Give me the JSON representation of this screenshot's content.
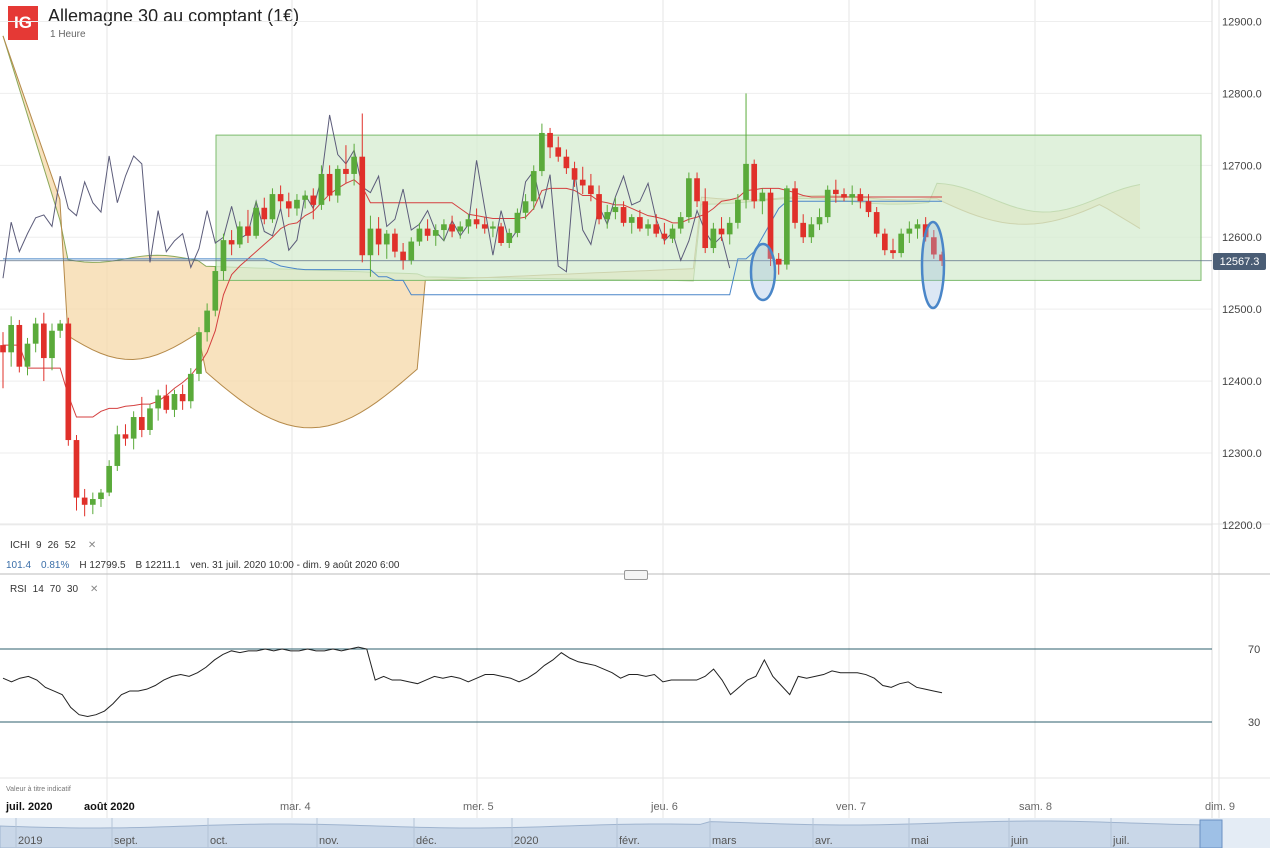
{
  "header": {
    "logo": "IG",
    "title": "Allemagne 30 au comptant (1€)",
    "timeframe": "1 Heure"
  },
  "indicators": {
    "ichimoku": {
      "name": "ICHI",
      "p1": "9",
      "p2": "26",
      "p3": "52"
    },
    "rsi": {
      "name": "RSI",
      "p1": "14",
      "p2": "70",
      "p3": "30"
    }
  },
  "stats": {
    "value": "101.4",
    "change": "0.81%",
    "high": "H 12799.5",
    "low": "B 12211.1",
    "range": "ven. 31 juil. 2020 10:00 - dim. 9 août 2020 6:00"
  },
  "price_tag": "12567.3",
  "disclaimer": "Valeur à titre indicatif",
  "colors": {
    "up": "#5aaa3a",
    "down": "#e0302a",
    "box_fill": "#d6ecd0",
    "box_stroke": "#7cbb6c",
    "cloud_orange": "#f6d8a8",
    "cloud_green": "#ddd7a8",
    "tenkan": "#d43f3f",
    "kijun": "#4a86c8",
    "chikou": "#5c5c7a",
    "span_a": "#8aa85a",
    "span_b": "#b58a4a",
    "rsi_line": "#222222",
    "rsi_levels": "#2c5f6e"
  },
  "chart_data": [
    {
      "type": "candlestick",
      "title": "Allemagne 30 au comptant (1€)",
      "ylim": [
        12150,
        12950
      ],
      "y_ticks": [
        "12900.0",
        "12800.0",
        "12700.0",
        "12600.0",
        "12500.0",
        "12400.0",
        "12300.0",
        "12200.0"
      ],
      "x_ticks": [
        "juil. 2020",
        "août 2020",
        "mar. 4",
        "mer. 5",
        "jeu. 6",
        "ven. 7",
        "sam. 8",
        "dim. 9"
      ],
      "last_price": 12567.3,
      "range_box": [
        12540,
        12742
      ],
      "candles": [
        [
          12450,
          12468,
          12390,
          12440
        ],
        [
          12440,
          12490,
          12420,
          12478
        ],
        [
          12478,
          12485,
          12412,
          12420
        ],
        [
          12420,
          12460,
          12408,
          12452
        ],
        [
          12452,
          12488,
          12440,
          12480
        ],
        [
          12480,
          12495,
          12400,
          12432
        ],
        [
          12432,
          12480,
          12415,
          12470
        ],
        [
          12470,
          12485,
          12460,
          12480
        ],
        [
          12480,
          12488,
          12310,
          12318
        ],
        [
          12318,
          12325,
          12220,
          12238
        ],
        [
          12238,
          12250,
          12212,
          12228
        ],
        [
          12228,
          12245,
          12215,
          12236
        ],
        [
          12236,
          12250,
          12225,
          12245
        ],
        [
          12245,
          12290,
          12240,
          12282
        ],
        [
          12282,
          12338,
          12275,
          12326
        ],
        [
          12326,
          12340,
          12310,
          12320
        ],
        [
          12320,
          12358,
          12305,
          12350
        ],
        [
          12350,
          12378,
          12322,
          12332
        ],
        [
          12332,
          12368,
          12325,
          12362
        ],
        [
          12362,
          12388,
          12345,
          12380
        ],
        [
          12380,
          12395,
          12355,
          12360
        ],
        [
          12360,
          12388,
          12350,
          12382
        ],
        [
          12382,
          12395,
          12360,
          12372
        ],
        [
          12372,
          12418,
          12362,
          12410
        ],
        [
          12410,
          12475,
          12400,
          12468
        ],
        [
          12468,
          12508,
          12455,
          12498
        ],
        [
          12498,
          12560,
          12490,
          12553
        ],
        [
          12553,
          12605,
          12540,
          12596
        ],
        [
          12596,
          12610,
          12575,
          12590
        ],
        [
          12590,
          12622,
          12585,
          12615
        ],
        [
          12615,
          12638,
          12592,
          12602
        ],
        [
          12602,
          12650,
          12598,
          12641
        ],
        [
          12641,
          12655,
          12618,
          12625
        ],
        [
          12625,
          12668,
          12620,
          12660
        ],
        [
          12660,
          12672,
          12640,
          12650
        ],
        [
          12650,
          12662,
          12628,
          12640
        ],
        [
          12640,
          12660,
          12630,
          12652
        ],
        [
          12652,
          12665,
          12640,
          12658
        ],
        [
          12658,
          12668,
          12625,
          12645
        ],
        [
          12645,
          12700,
          12638,
          12688
        ],
        [
          12688,
          12700,
          12650,
          12658
        ],
        [
          12658,
          12700,
          12648,
          12695
        ],
        [
          12695,
          12728,
          12675,
          12688
        ],
        [
          12688,
          12730,
          12672,
          12712
        ],
        [
          12712,
          12772,
          12565,
          12575
        ],
        [
          12575,
          12630,
          12545,
          12612
        ],
        [
          12612,
          12628,
          12575,
          12590
        ],
        [
          12590,
          12610,
          12570,
          12605
        ],
        [
          12605,
          12612,
          12572,
          12580
        ],
        [
          12580,
          12592,
          12555,
          12568
        ],
        [
          12568,
          12600,
          12562,
          12594
        ],
        [
          12594,
          12620,
          12588,
          12612
        ],
        [
          12612,
          12625,
          12595,
          12602
        ],
        [
          12602,
          12618,
          12588,
          12610
        ],
        [
          12610,
          12625,
          12595,
          12618
        ],
        [
          12618,
          12630,
          12600,
          12608
        ],
        [
          12608,
          12622,
          12598,
          12615
        ],
        [
          12615,
          12632,
          12605,
          12625
        ],
        [
          12625,
          12640,
          12612,
          12618
        ],
        [
          12618,
          12628,
          12605,
          12612
        ],
        [
          12612,
          12622,
          12600,
          12615
        ],
        [
          12615,
          12620,
          12588,
          12592
        ],
        [
          12592,
          12612,
          12585,
          12606
        ],
        [
          12606,
          12640,
          12600,
          12634
        ],
        [
          12634,
          12660,
          12625,
          12650
        ],
        [
          12650,
          12700,
          12638,
          12692
        ],
        [
          12692,
          12758,
          12685,
          12745
        ],
        [
          12745,
          12752,
          12710,
          12725
        ],
        [
          12725,
          12740,
          12705,
          12712
        ],
        [
          12712,
          12722,
          12688,
          12696
        ],
        [
          12696,
          12705,
          12670,
          12680
        ],
        [
          12680,
          12698,
          12660,
          12672
        ],
        [
          12672,
          12688,
          12650,
          12660
        ],
        [
          12660,
          12672,
          12618,
          12625
        ],
        [
          12625,
          12645,
          12612,
          12635
        ],
        [
          12635,
          12655,
          12625,
          12642
        ],
        [
          12642,
          12650,
          12615,
          12620
        ],
        [
          12620,
          12632,
          12605,
          12628
        ],
        [
          12628,
          12638,
          12608,
          12612
        ],
        [
          12612,
          12625,
          12602,
          12618
        ],
        [
          12618,
          12632,
          12600,
          12605
        ],
        [
          12605,
          12620,
          12590,
          12598
        ],
        [
          12598,
          12618,
          12592,
          12612
        ],
        [
          12612,
          12635,
          12605,
          12628
        ],
        [
          12628,
          12690,
          12620,
          12682
        ],
        [
          12682,
          12690,
          12642,
          12650
        ],
        [
          12650,
          12668,
          12578,
          12585
        ],
        [
          12585,
          12620,
          12578,
          12612
        ],
        [
          12612,
          12628,
          12595,
          12604
        ],
        [
          12604,
          12628,
          12590,
          12620
        ],
        [
          12620,
          12660,
          12612,
          12652
        ],
        [
          12652,
          12800,
          12640,
          12702
        ],
        [
          12702,
          12708,
          12640,
          12650
        ],
        [
          12650,
          12668,
          12632,
          12662
        ],
        [
          12662,
          12668,
          12560,
          12570
        ],
        [
          12570,
          12578,
          12548,
          12562
        ],
        [
          12562,
          12672,
          12555,
          12668
        ],
        [
          12668,
          12678,
          12612,
          12620
        ],
        [
          12620,
          12632,
          12592,
          12600
        ],
        [
          12600,
          12628,
          12592,
          12618
        ],
        [
          12618,
          12640,
          12610,
          12628
        ],
        [
          12628,
          12672,
          12620,
          12666
        ],
        [
          12666,
          12680,
          12648,
          12660
        ],
        [
          12660,
          12668,
          12650,
          12655
        ],
        [
          12655,
          12672,
          12645,
          12660
        ],
        [
          12660,
          12668,
          12640,
          12650
        ],
        [
          12650,
          12660,
          12628,
          12635
        ],
        [
          12635,
          12642,
          12600,
          12605
        ],
        [
          12605,
          12612,
          12575,
          12582
        ],
        [
          12582,
          12598,
          12570,
          12578
        ],
        [
          12578,
          12612,
          12572,
          12605
        ],
        [
          12605,
          12622,
          12592,
          12612
        ],
        [
          12612,
          12625,
          12598,
          12618
        ],
        [
          12618,
          12628,
          12594,
          12600
        ],
        [
          12600,
          12610,
          12570,
          12576
        ],
        [
          12576,
          12580,
          12560,
          12567
        ]
      ]
    },
    {
      "type": "line",
      "title": "RSI",
      "levels": [
        70,
        30
      ],
      "y_ticks": [
        "70",
        "30"
      ],
      "ylim": [
        10,
        90
      ],
      "values": [
        54,
        52,
        54,
        55,
        53,
        49,
        47,
        45,
        38,
        34,
        33,
        34,
        36,
        40,
        45,
        47,
        47,
        48,
        50,
        53,
        55,
        56,
        55,
        57,
        60,
        64,
        67,
        69,
        68,
        69,
        69,
        70,
        69,
        70,
        69,
        69,
        70,
        69,
        69,
        70,
        69,
        70,
        71,
        70,
        53,
        55,
        53,
        53,
        52,
        51,
        53,
        55,
        54,
        55,
        54,
        52,
        54,
        56,
        56,
        55,
        54,
        52,
        54,
        57,
        61,
        64,
        68,
        65,
        63,
        62,
        61,
        59,
        57,
        54,
        56,
        56,
        55,
        56,
        52,
        53,
        53,
        53,
        53,
        55,
        59,
        53,
        45,
        49,
        53,
        55,
        64,
        55,
        50,
        45,
        55,
        54,
        55,
        56,
        58,
        57,
        57,
        57,
        56,
        54,
        50,
        49,
        51,
        52,
        49,
        48,
        47,
        46
      ]
    }
  ],
  "ichimoku": {
    "tenkan": [
      12450,
      12450,
      12450,
      12418,
      12418,
      12418,
      12418,
      12418,
      12380,
      12350,
      12350,
      12350,
      12358,
      12362,
      12362,
      12365,
      12366,
      12368,
      12368,
      12372,
      12380,
      12390,
      12398,
      12408,
      12422,
      12440,
      12470,
      12520,
      12548,
      12560,
      12570,
      12580,
      12590,
      12600,
      12612,
      12618,
      12620,
      12630,
      12636,
      12648,
      12660,
      12668,
      12675,
      12680,
      12670,
      12648,
      12648,
      12648,
      12648,
      12648,
      12648,
      12648,
      12648,
      12648,
      12648,
      12648,
      12640,
      12632,
      12630,
      12628,
      12626,
      12626,
      12626,
      12626,
      12628,
      12640,
      12665,
      12668,
      12668,
      12668,
      12665,
      12658,
      12658,
      12650,
      12648,
      12645,
      12645,
      12640,
      12635,
      12630,
      12628,
      12625,
      12620,
      12620,
      12625,
      12628,
      12632,
      12640,
      12650,
      12652,
      12655,
      12665,
      12666,
      12668,
      12668,
      12668,
      12665,
      12662,
      12658,
      12656,
      12656,
      12656,
      12656,
      12656,
      12656,
      12656,
      12656,
      12656,
      12656,
      12656,
      12656,
      12656,
      12656,
      12656,
      12656,
      12656
    ],
    "kijun": [
      12570,
      12570,
      12570,
      12570,
      12570,
      12570,
      12570,
      12570,
      12570,
      12570,
      12570,
      12570,
      12570,
      12570,
      12570,
      12570,
      12570,
      12570,
      12570,
      12570,
      12570,
      12570,
      12570,
      12570,
      12570,
      12570,
      12570,
      12570,
      12570,
      12570,
      12570,
      12570,
      12570,
      12565,
      12560,
      12558,
      12556,
      12555,
      12555,
      12555,
      12555,
      12555,
      12555,
      12555,
      12555,
      12555,
      12545,
      12545,
      12540,
      12540,
      12520,
      12520,
      12520,
      12520,
      12520,
      12520,
      12520,
      12520,
      12520,
      12520,
      12520,
      12520,
      12520,
      12520,
      12520,
      12520,
      12520,
      12520,
      12520,
      12520,
      12520,
      12520,
      12520,
      12520,
      12520,
      12520,
      12520,
      12520,
      12520,
      12520,
      12520,
      12520,
      12520,
      12520,
      12520,
      12520,
      12520,
      12520,
      12520,
      12520,
      12570,
      12570,
      12580,
      12600,
      12620,
      12640,
      12650,
      12650,
      12650,
      12650,
      12650,
      12650,
      12650,
      12650,
      12650,
      12650,
      12650,
      12650,
      12650,
      12650,
      12650,
      12650,
      12650,
      12650,
      12650,
      12650
    ],
    "note": "overlay lines are approximate visual reconstructions"
  }
}
